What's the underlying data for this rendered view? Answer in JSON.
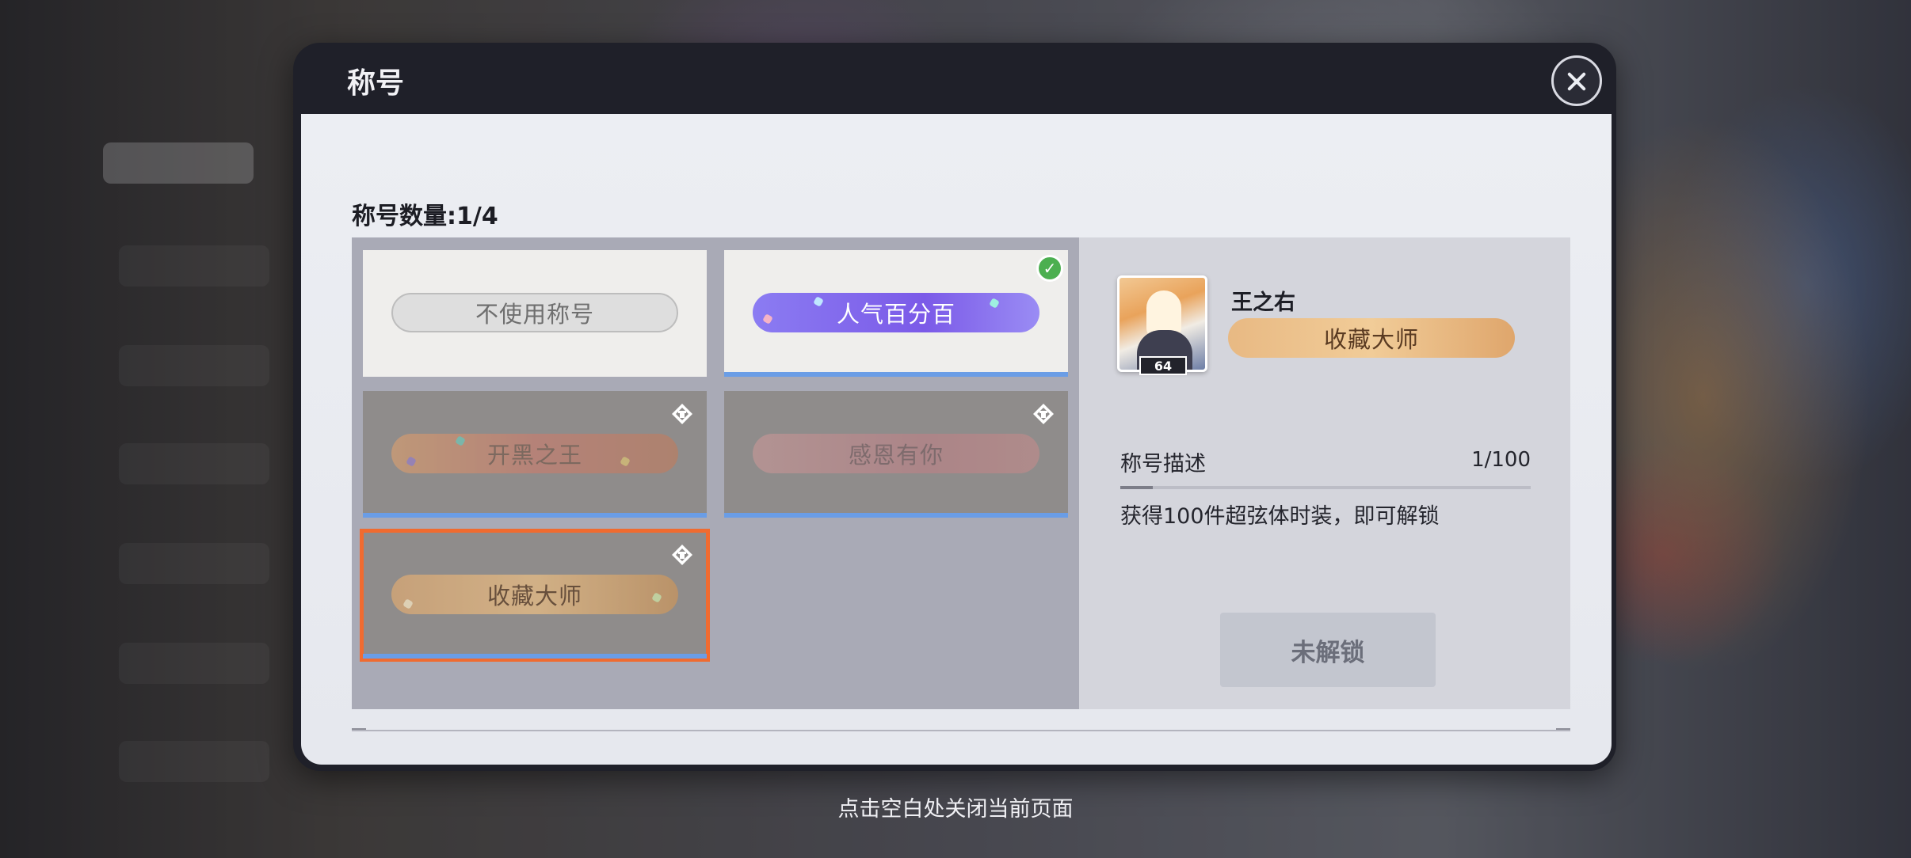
{
  "dialog": {
    "title": "称号",
    "count_label": "称号数量:1/4"
  },
  "titles": [
    {
      "label": "不使用称号",
      "style": "none",
      "state": "available",
      "equipped": false,
      "selected": false
    },
    {
      "label": "人气百分百",
      "style": "popular",
      "state": "owned",
      "equipped": true,
      "selected": false
    },
    {
      "label": "开黑之王",
      "style": "king",
      "state": "locked",
      "equipped": false,
      "selected": false
    },
    {
      "label": "感恩有你",
      "style": "thanks",
      "state": "locked",
      "equipped": false,
      "selected": false
    },
    {
      "label": "收藏大师",
      "style": "collector",
      "state": "locked",
      "equipped": false,
      "selected": true
    }
  ],
  "detail": {
    "player_name": "王之右",
    "avatar_level": "64",
    "title_label": "收藏大师",
    "desc_heading": "称号描述",
    "progress_text": "1/100",
    "progress_fraction": 0.01,
    "description": "获得100件超弦体时装，即可解锁",
    "unlock_button": "未解锁"
  },
  "footer_hint": "点击空白处关闭当前页面",
  "colors": {
    "selected_outline": "#f06b30",
    "tile_underline": "#6a9de6",
    "equipped_check": "#4caf50"
  },
  "icons": {
    "close": "close-icon",
    "equipped": "check-icon",
    "locked": "lock-icon"
  }
}
